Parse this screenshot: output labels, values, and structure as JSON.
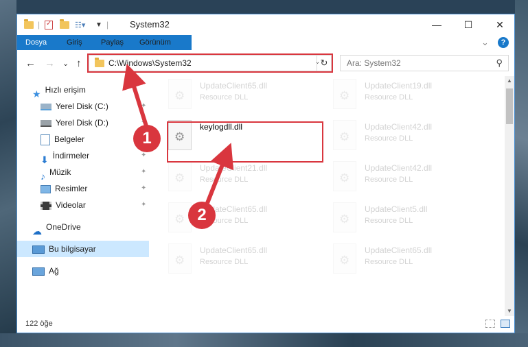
{
  "window": {
    "title": "System32",
    "minimize": "—",
    "maximize": "☐",
    "close": "✕"
  },
  "ribbon": {
    "tabs": [
      "Dosya",
      "Giriş",
      "Paylaş",
      "Görünüm"
    ],
    "expand": "⌄",
    "help": "?"
  },
  "nav": {
    "back": "←",
    "forward": "→",
    "recent": "⌄",
    "up": "↑",
    "address": "C:\\Windows\\System32",
    "address_dropdown": "⌄",
    "refresh": "↻",
    "search_placeholder": "Ara: System32",
    "search_icon": "⚲"
  },
  "sidebar": {
    "items": [
      {
        "label": "Hızlı erişim",
        "icon": "star-icon",
        "pinned": false
      },
      {
        "label": "Yerel Disk (C:)",
        "icon": "drive-icon",
        "pinned": true
      },
      {
        "label": "Yerel Disk (D:)",
        "icon": "drive-icon",
        "pinned": true
      },
      {
        "label": "Belgeler",
        "icon": "documents-icon",
        "pinned": true
      },
      {
        "label": "İndirmeler",
        "icon": "download-icon",
        "pinned": true
      },
      {
        "label": "Müzik",
        "icon": "music-icon",
        "pinned": true
      },
      {
        "label": "Resimler",
        "icon": "pictures-icon",
        "pinned": true
      },
      {
        "label": "Videolar",
        "icon": "videos-icon",
        "pinned": true
      },
      {
        "label": "OneDrive",
        "icon": "cloud-icon",
        "pinned": false
      },
      {
        "label": "Bu bilgisayar",
        "icon": "computer-icon",
        "pinned": false,
        "selected": true
      },
      {
        "label": "Ağ",
        "icon": "network-icon",
        "pinned": false
      }
    ],
    "pin_glyph": "📌"
  },
  "files": [
    {
      "name": "UpdateClient65.dll",
      "desc": "Resource DLL",
      "faded": true
    },
    {
      "name": "UpdateClient19.dll",
      "desc": "Resource DLL",
      "faded": true
    },
    {
      "name": "keylogdll.dll",
      "desc": "",
      "faded": false
    },
    {
      "name": "UpdateClient42.dll",
      "desc": "Resource DLL",
      "faded": true
    },
    {
      "name": "UpdateClient21.dll",
      "desc": "Resource DLL",
      "faded": true
    },
    {
      "name": "UpdateClient42.dll",
      "desc": "Resource DLL",
      "faded": true
    },
    {
      "name": "UpdateClient65.dll",
      "desc": "Resource DLL",
      "faded": true
    },
    {
      "name": "UpdateClient5.dll",
      "desc": "Resource DLL",
      "faded": true
    },
    {
      "name": "UpdateClient65.dll",
      "desc": "Resource DLL",
      "faded": true
    },
    {
      "name": "UpdateClient65.dll",
      "desc": "Resource DLL",
      "faded": true
    }
  ],
  "status": {
    "count": "122 öğe"
  },
  "annotations": {
    "badge1": "1",
    "badge2": "2",
    "color": "#d9363e"
  }
}
